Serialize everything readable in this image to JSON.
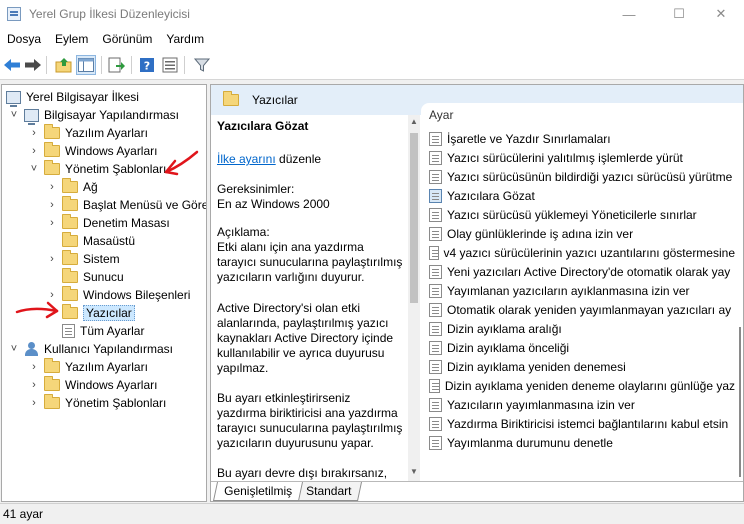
{
  "window": {
    "title": "Yerel Grup İlkesi Düzenleyicisi",
    "minimize_glyph": "—",
    "maximize_glyph": "☐",
    "close_glyph": "✕"
  },
  "menu": [
    "Dosya",
    "Eylem",
    "Görünüm",
    "Yardım"
  ],
  "toolbar": {
    "icons": [
      "back-arrow-icon",
      "forward-arrow-icon",
      "up-folder-icon",
      "show-hide-tree-icon",
      "export-list-icon",
      "help-icon",
      "properties-icon",
      "filter-icon"
    ]
  },
  "tree": {
    "items": [
      {
        "label": "Yerel Bilgisayar İlkesi",
        "icon": "computer-icon",
        "expander": ""
      },
      {
        "label": "Bilgisayar Yapılandırması",
        "icon": "computer-icon",
        "expander": "˅"
      },
      {
        "label": "Yazılım Ayarları",
        "icon": "folder-icon",
        "expander": "›"
      },
      {
        "label": "Windows Ayarları",
        "icon": "folder-icon",
        "expander": "›"
      },
      {
        "label": "Yönetim Şablonları",
        "icon": "folder-icon",
        "expander": "˅"
      },
      {
        "label": "Ağ",
        "icon": "folder-icon",
        "expander": "›"
      },
      {
        "label": "Başlat Menüsü ve Görev",
        "icon": "folder-icon",
        "expander": "›"
      },
      {
        "label": "Denetim Masası",
        "icon": "folder-icon",
        "expander": "›"
      },
      {
        "label": "Masaüstü",
        "icon": "folder-icon",
        "expander": ""
      },
      {
        "label": "Sistem",
        "icon": "folder-icon",
        "expander": "›"
      },
      {
        "label": "Sunucu",
        "icon": "folder-icon",
        "expander": ""
      },
      {
        "label": "Windows Bileşenleri",
        "icon": "folder-icon",
        "expander": "›"
      },
      {
        "label": "Yazıcılar",
        "icon": "folder-icon",
        "expander": ""
      },
      {
        "label": "Tüm Ayarlar",
        "icon": "policy-icon",
        "expander": ""
      },
      {
        "label": "Kullanıcı Yapılandırması",
        "icon": "user-icon",
        "expander": "˅"
      },
      {
        "label": "Yazılım Ayarları",
        "icon": "folder-icon",
        "expander": "›"
      },
      {
        "label": "Windows Ayarları",
        "icon": "folder-icon",
        "expander": "›"
      },
      {
        "label": "Yönetim Şablonları",
        "icon": "folder-icon",
        "expander": "›"
      }
    ]
  },
  "right": {
    "header": "Yazıcılar",
    "desc": {
      "title": "Yazıcılara Gözat",
      "link": "İlke ayarını",
      "link_suffix": " düzenle",
      "req_label": "Gereksinimler:",
      "req_value": "En az Windows 2000",
      "desc_label": "Açıklama:",
      "para1": "Etki alanı için ana yazdırma tarayıcı sunucularına paylaştırılmış yazıcıların varlığını duyurur.",
      "para2": "Active Directory'si olan etki alanlarında, paylaştırılmış yazıcı kaynakları Active Directory içinde kullanılabilir ve ayrıca duyurusu yapılmaz.",
      "para3": "Bu ayarı etkinleştirirseniz yazdırma biriktiricisi ana yazdırma tarayıcı sunucularına paylaştırılmış yazıcıların duyurusunu yapar.",
      "para4": "Bu ayarı devre dışı bırakırsanız,"
    },
    "list": {
      "column": "Ayar",
      "items": [
        "İşaretle ve Yazdır Sınırlamaları",
        "Yazıcı sürücülerini yalıtılmış işlemlerde yürüt",
        "Yazıcı sürücüsünün bildirdiği yazıcı sürücüsü yürütme",
        "Yazıcılara Gözat",
        "Yazıcı sürücüsü yüklemeyi Yöneticilerle sınırlar",
        "Olay günlüklerinde iş adına izin ver",
        "v4 yazıcı sürücülerinin yazıcı uzantılarını göstermesine",
        "Yeni yazıcıları Active Directory'de otomatik olarak yay",
        "Yayımlanan yazıcıların ayıklanmasına izin ver",
        "Otomatik olarak yeniden yayımlanmayan yazıcıları ay",
        "Dizin ayıklama aralığı",
        "Dizin ayıklama önceliği",
        "Dizin ayıklama yeniden denemesi",
        "Dizin ayıklama yeniden deneme olaylarını günlüğe yaz",
        "Yazıcıların yayımlanmasına izin ver",
        "Yazdırma Biriktiricisi istemci bağlantılarını kabul etsin",
        "Yayımlanma durumunu denetle"
      ]
    },
    "tabs": [
      "Genişletilmiş",
      "Standart"
    ]
  },
  "status": "41 ayar",
  "colors": {
    "annotation": "#e0151b",
    "header_bg": "#e3eef9",
    "link": "#0066cc"
  }
}
